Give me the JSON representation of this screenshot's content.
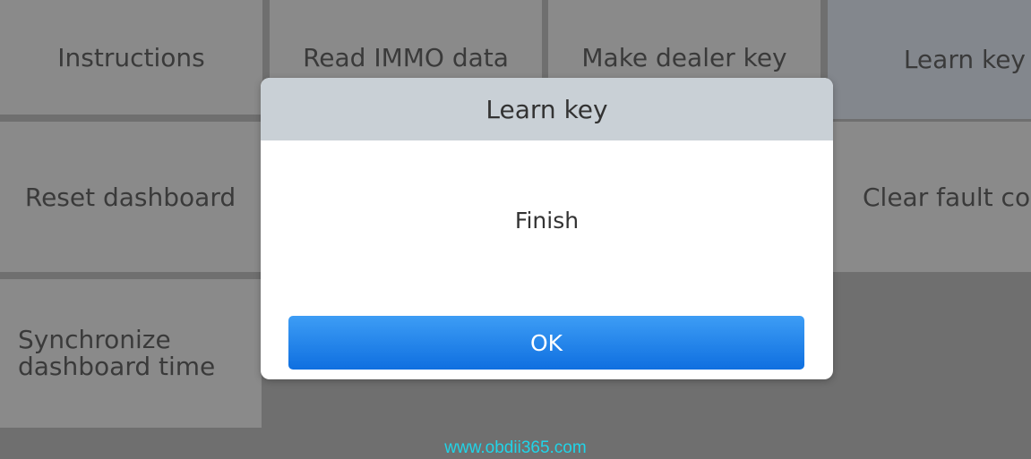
{
  "menu": {
    "instructions": "Instructions",
    "read_immo_data": "Read IMMO data",
    "make_dealer_key": "Make dealer key",
    "learn_key": "Learn key",
    "reset_dashboard": "Reset dashboard",
    "clear_fault_codes": "Clear fault co",
    "synchronize_dashboard_time": "Synchronize dashboard time"
  },
  "dialog": {
    "title": "Learn key",
    "message": "Finish",
    "ok_label": "OK"
  },
  "watermark": "www.obdii365.com",
  "colors": {
    "ok_button": "#1a7fe8",
    "dialog_header": "#c9d0d6",
    "watermark": "#20d4e8"
  }
}
